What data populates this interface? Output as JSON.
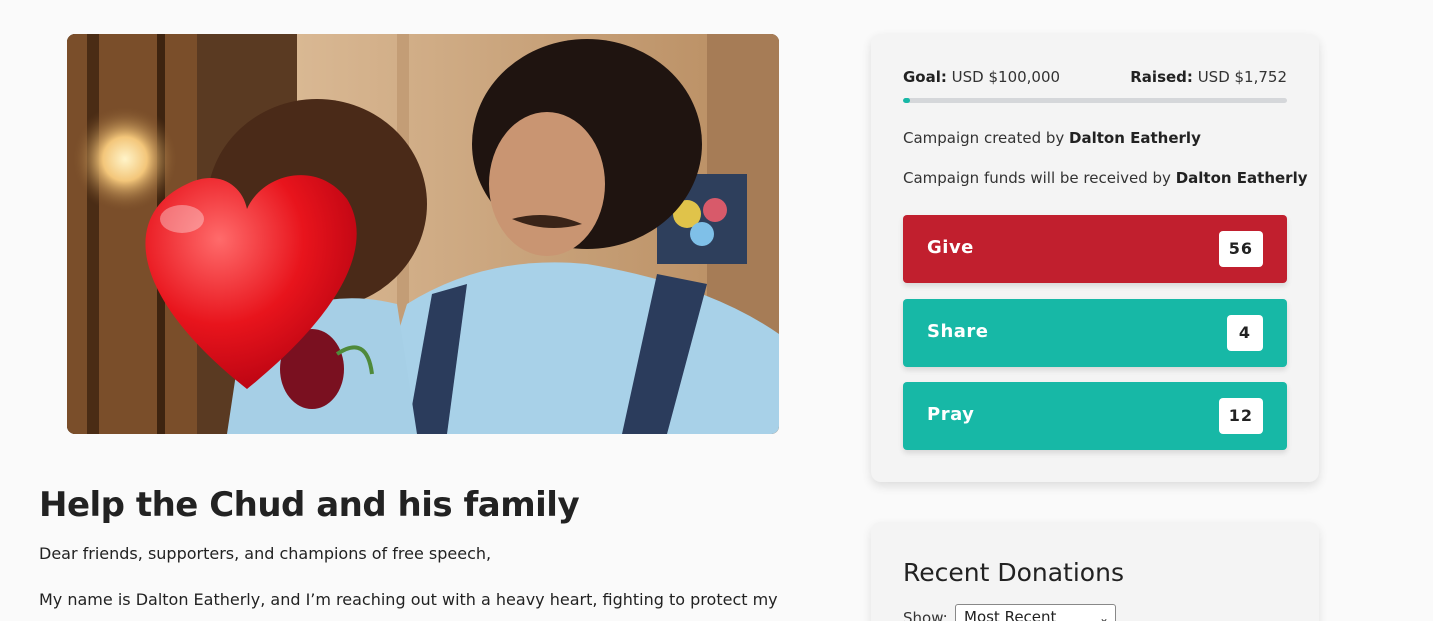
{
  "campaign": {
    "title": "Help the Chud and his family",
    "paragraphs": [
      "Dear friends, supporters, and champions of free speech,",
      "My name is Dalton Eatherly, and I’m reaching out with a heavy heart, fighting to protect my"
    ]
  },
  "stats": {
    "goal_label": "Goal:",
    "goal_value": "USD $100,000",
    "raised_label": "Raised:",
    "raised_value": "USD $1,752",
    "progress_fraction": 0.01752,
    "created_by_prefix": "Campaign created by",
    "created_by_name": "Dalton Eatherly",
    "received_by_prefix": "Campaign funds will be received by",
    "received_by_name": "Dalton Eatherly"
  },
  "actions": {
    "give": {
      "label": "Give",
      "count": "56",
      "color": "#c11f2e"
    },
    "share": {
      "label": "Share",
      "count": "4",
      "color": "#17b8a6"
    },
    "pray": {
      "label": "Pray",
      "count": "12",
      "color": "#17b8a6"
    }
  },
  "donations": {
    "heading": "Recent Donations",
    "show_label": "Show:",
    "selected_sort": "Most Recent"
  },
  "colors": {
    "accent": "#17b8a6",
    "give": "#c11f2e"
  }
}
